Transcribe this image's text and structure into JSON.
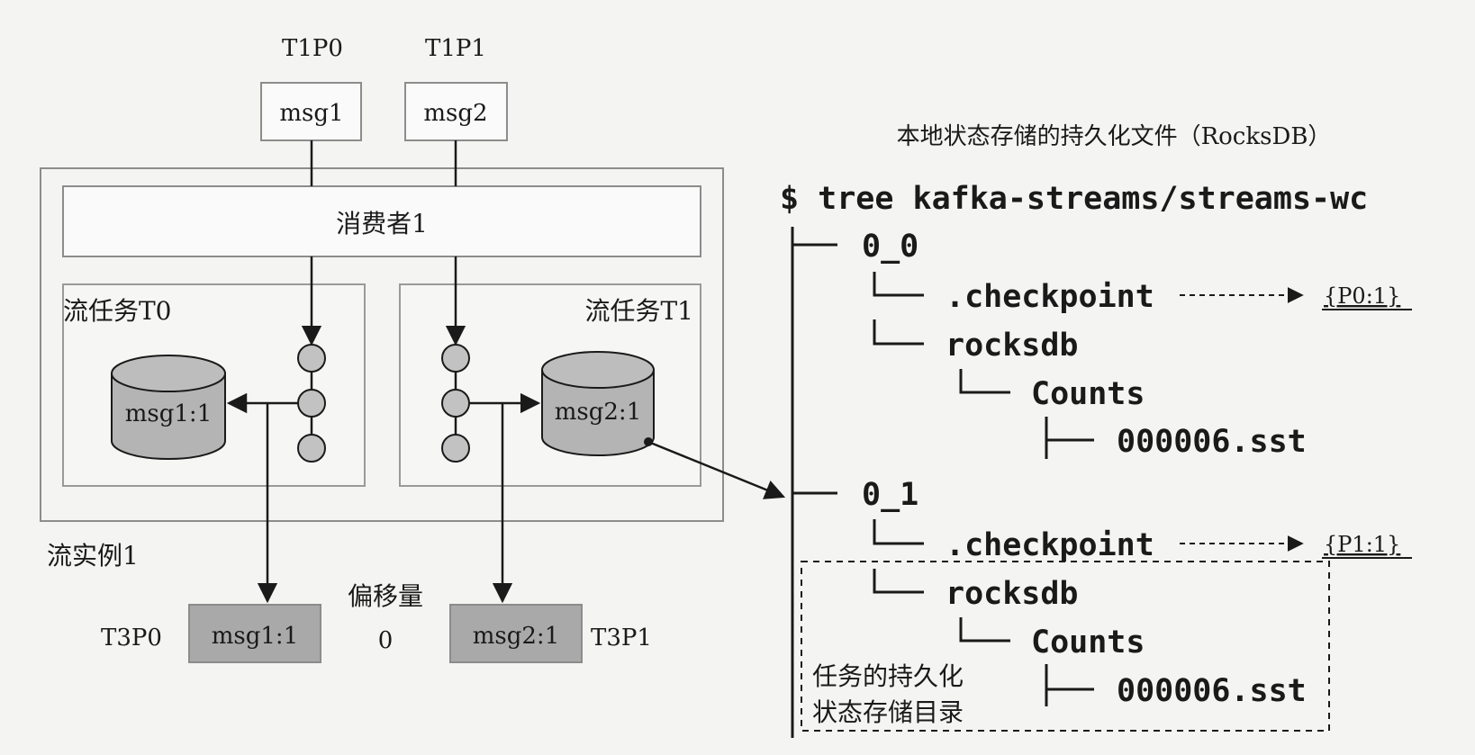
{
  "left": {
    "partitions": [
      {
        "id": "T1P0",
        "msg": "msg1"
      },
      {
        "id": "T1P1",
        "msg": "msg2"
      }
    ],
    "consumer": "消费者1",
    "tasks": [
      {
        "label": "流任务T0",
        "store": "msg1:1"
      },
      {
        "label": "流任务T1",
        "store": "msg2:1"
      }
    ],
    "instance": "流实例1",
    "offset": {
      "label": "偏移量",
      "value": "0"
    },
    "outputs": [
      {
        "id": "T3P0",
        "msg": "msg1:1"
      },
      {
        "id": "T3P1",
        "msg": "msg2:1"
      }
    ]
  },
  "right": {
    "caption": "本地状态存储的持久化文件（RocksDB）",
    "command": "$ tree kafka-streams/streams-wc",
    "tree": {
      "dir0": "0_0",
      "dir1": "0_1",
      "checkpoint": ".checkpoint",
      "rocksdb": "rocksdb",
      "counts": "Counts",
      "sst": "000006.sst",
      "checkpoint_value_0": "{P0:1}",
      "checkpoint_value_1": "{P1:1}"
    },
    "dir_note_line1": "任务的持久化",
    "dir_note_line2": "状态存储目录"
  },
  "colors": {
    "line": "#1a1a1a",
    "box_border": "#8c8c8c",
    "cylinder_fill": "#b4b4b4",
    "output_fill": "#a9a9a9",
    "circle_fill": "#c2c2c2"
  }
}
